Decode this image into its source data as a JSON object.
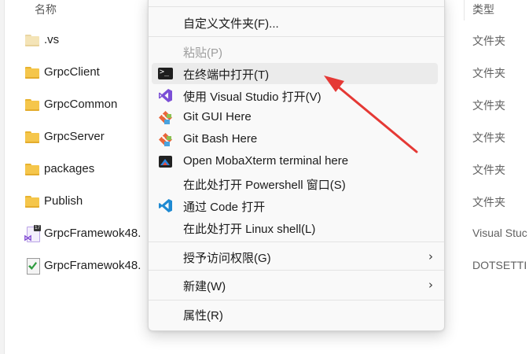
{
  "columns": {
    "name": "名称",
    "type": "类型"
  },
  "files": [
    {
      "name": ".vs",
      "type": "文件夹",
      "icon": "folder-icon-light"
    },
    {
      "name": "GrpcClient",
      "type": "文件夹",
      "icon": "folder-icon"
    },
    {
      "name": "GrpcCommon",
      "type": "文件夹",
      "icon": "folder-icon"
    },
    {
      "name": "GrpcServer",
      "type": "文件夹",
      "icon": "folder-icon"
    },
    {
      "name": "packages",
      "type": "文件夹",
      "icon": "folder-icon"
    },
    {
      "name": "Publish",
      "type": "文件夹",
      "icon": "folder-icon"
    },
    {
      "name": "GrpcFramewok48.",
      "type": "Visual Stuc",
      "icon": "visual-studio-solution-icon"
    },
    {
      "name": "GrpcFramewok48.",
      "type": "DOTSETTI",
      "icon": "settings-file-icon"
    }
  ],
  "menu": {
    "items": [
      {
        "label": "自定义文件夹(F)...",
        "icon": ""
      },
      {
        "label": "粘贴(P)",
        "icon": "",
        "disabled": true
      },
      {
        "label": "在终端中打开(T)",
        "icon": "terminal-icon",
        "hover": true
      },
      {
        "label": "使用 Visual Studio 打开(V)",
        "icon": "visual-studio-icon"
      },
      {
        "label": "Git GUI Here",
        "icon": "git-icon"
      },
      {
        "label": "Git Bash Here",
        "icon": "git-icon"
      },
      {
        "label": "Open MobaXterm terminal here",
        "icon": "mobaxterm-icon"
      },
      {
        "label": "在此处打开 Powershell 窗口(S)",
        "icon": ""
      },
      {
        "label": "通过 Code 打开",
        "icon": "vscode-icon"
      },
      {
        "label": "在此处打开 Linux shell(L)",
        "icon": ""
      },
      {
        "label": "授予访问权限(G)",
        "icon": "",
        "submenu": true
      },
      {
        "label": "新建(W)",
        "icon": "",
        "submenu": true
      },
      {
        "label": "属性(R)",
        "icon": ""
      }
    ]
  },
  "annotation": {
    "arrow_color": "#e53935"
  },
  "colors": {
    "folder": "#f5c64b",
    "menu_bg": "#f9f9f9",
    "hover_bg": "#ebebeb"
  }
}
